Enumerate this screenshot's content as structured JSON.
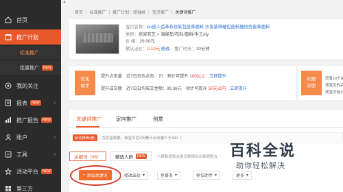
{
  "sidebar": {
    "items": [
      {
        "label": "首页",
        "icon": "home-icon"
      },
      {
        "label": "推广计划",
        "icon": "plan-icon"
      },
      {
        "label": "我的关注",
        "icon": "watch-icon"
      },
      {
        "label": "报表",
        "icon": "report-icon",
        "badge": "NEW"
      },
      {
        "label": "推广报告",
        "icon": "chart-icon",
        "badge": "NEW"
      },
      {
        "label": "账户",
        "icon": "account-icon"
      },
      {
        "label": "工具",
        "icon": "tool-icon"
      },
      {
        "label": "活动平台",
        "icon": "activity-icon",
        "badge": "NEW"
      },
      {
        "label": "第三方",
        "icon": "third-party-icon"
      }
    ],
    "subitems": [
      {
        "label": "标准推广"
      },
      {
        "label": "批量推广",
        "badge": "NEW"
      }
    ]
  },
  "breadcrumb": {
    "items": [
      "首页",
      "标准推广",
      "推广计划：短袖纹",
      "宝贝推广",
      "关键词推广"
    ]
  },
  "product": {
    "title_label": "宝贝名称：",
    "title": "pu皮人造革布纹软包皮革面料 沙发装饰硬包皮料细纹仿皮革面料",
    "category_label": "类目：",
    "category": "居家布艺 > 海绵垫/布料/面料/手工diy",
    "price_label": "价   格：",
    "price": "29.00元",
    "bid_label": "默认出价：",
    "bid": "0.10元",
    "edit": "修改",
    "ctr_label": "推广时长：",
    "ctr": "10分钟"
  },
  "optimize": {
    "badge": "优化\n助手",
    "row1": {
      "action": "提升点击量",
      "desc": "近7日日均点击：70",
      "predict": "预计可提升",
      "delta": "100以上",
      "link": "立即提升"
    },
    "row2": {
      "action": "提升成交额",
      "desc": "近7日日均成交金额：99.36元",
      "predict": "预计可提升",
      "delta": "50元以内",
      "link": "立即提升"
    }
  },
  "diagnose": {
    "badge": "问题\n诊断",
    "line1": "您有10个关键词",
    "line2": "该宝贝的关键词",
    "line3": "该宝贝有3个"
  },
  "tabs": {
    "items": [
      "关键词推广",
      "定向推广",
      "创意"
    ]
  },
  "tip": {
    "badge": "新词推荐(荐)",
    "text": "为保证效果，该宝贝近3天累计点击量少于300（"
  },
  "subtabs": {
    "keyword": "关键词（66）",
    "selected": "精选人群",
    "selected_badge": "NEW",
    "note": "人群数据和关键词数据综合数据整合"
  },
  "toolbar": {
    "add_label": "添加关键词",
    "dropdowns": [
      "修改出价",
      "抢首条",
      "抢位助手",
      "更多"
    ]
  },
  "watermark": {
    "title": "百科全说",
    "subtitle": "助你轻松解决"
  }
}
